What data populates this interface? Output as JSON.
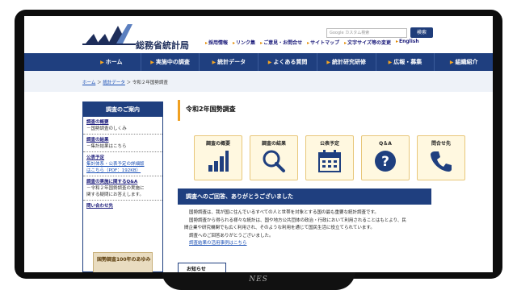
{
  "header": {
    "ministry_name": "総務省統計局",
    "search_placeholder": "Google カスタム検索",
    "search_button": "検索",
    "util_links": [
      "採用情報",
      "リンク集",
      "ご意見・お問合せ",
      "サイトマップ",
      "文字サイズ等の変更",
      "English"
    ]
  },
  "nav": {
    "items": [
      "ホーム",
      "実施中の調査",
      "統計データ",
      "よくある質問",
      "統計研究研修",
      "広報・募集",
      "組織紹介"
    ]
  },
  "breadcrumb": {
    "home": "ホーム",
    "sep1": "＞",
    "data": "統計データ",
    "sep2": "＞",
    "current": "令和２年国勢調査"
  },
  "sidebar": {
    "heading": "調査のご案内",
    "sections": [
      {
        "title": "調査の概要",
        "lines": [
          "－国勢調査のしくみ"
        ]
      },
      {
        "title": "調査の結果",
        "lines": [
          "－集計結果はこちら"
        ]
      },
      {
        "title": "公表予定",
        "link_lines": [
          "集計体系・公表予定の詳細版",
          "はこちら（PDF：192KB）"
        ]
      },
      {
        "title": "調査の実施に関するQ&A",
        "lines": [
          "－令和２年国勢調査の実施に",
          "関する疑問にお答えします。"
        ]
      },
      {
        "title": "問い合わせ先",
        "lines": []
      }
    ],
    "banner_text": "国勢調査100年のあゆみ"
  },
  "main": {
    "title": "令和2年国勢調査",
    "tiles": [
      {
        "label": "調査の概要",
        "icon": "bar-chart-icon"
      },
      {
        "label": "調査の結果",
        "icon": "magnifier-icon"
      },
      {
        "label": "公表予定",
        "icon": "calendar-icon"
      },
      {
        "label": "Q＆A",
        "icon": "question-icon"
      },
      {
        "label": "問合せ先",
        "icon": "phone-icon"
      }
    ],
    "banner": "調査へのご回答、ありがとうございました",
    "body": [
      "国勢調査は、我が国に住んでいるすべての人と世帯を対象とする国の最も重要な統計調査です。",
      "国勢調査から得られる様々な統計は、国や地方公共団体の政治・行政において利用されることはもとより、民",
      "間企業や研究機関でも広く利用され、そのような利用を通じて国民生活に役立てられています。",
      "調査へのご回答ありがとうございました。"
    ],
    "body_link": "調査結果の活用事例はこちら",
    "bottom_card": "お知らせ"
  },
  "stand_label": "NES",
  "colors": {
    "navy": "#1f3f7f",
    "tile_bg": "#fff8e0",
    "accent": "#f0a020"
  }
}
